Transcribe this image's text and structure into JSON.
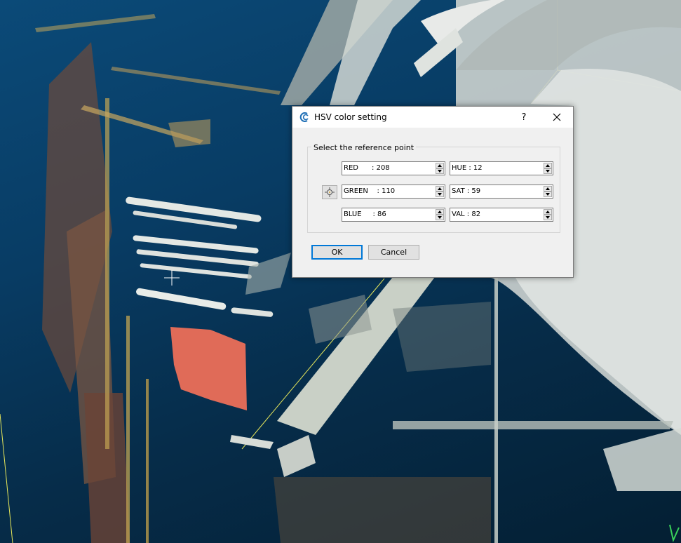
{
  "dialog": {
    "title": "HSV color setting",
    "help_label": "?",
    "close_icon": "close-icon",
    "app_icon": "cloudcompare-icon",
    "group_title": "Select the reference point",
    "picker_icon": "point-picker-icon",
    "fields": {
      "red": "RED      : 208",
      "green": "GREEN    : 110",
      "blue": "BLUE     : 86",
      "hue": "HUE : 12",
      "sat": "SAT : 59",
      "val": "VAL : 82"
    },
    "ok_label": "OK",
    "cancel_label": "Cancel"
  },
  "colors": {
    "accent": "#0078d7",
    "background": "#083c64",
    "highlight_patch": "#e06b58"
  }
}
